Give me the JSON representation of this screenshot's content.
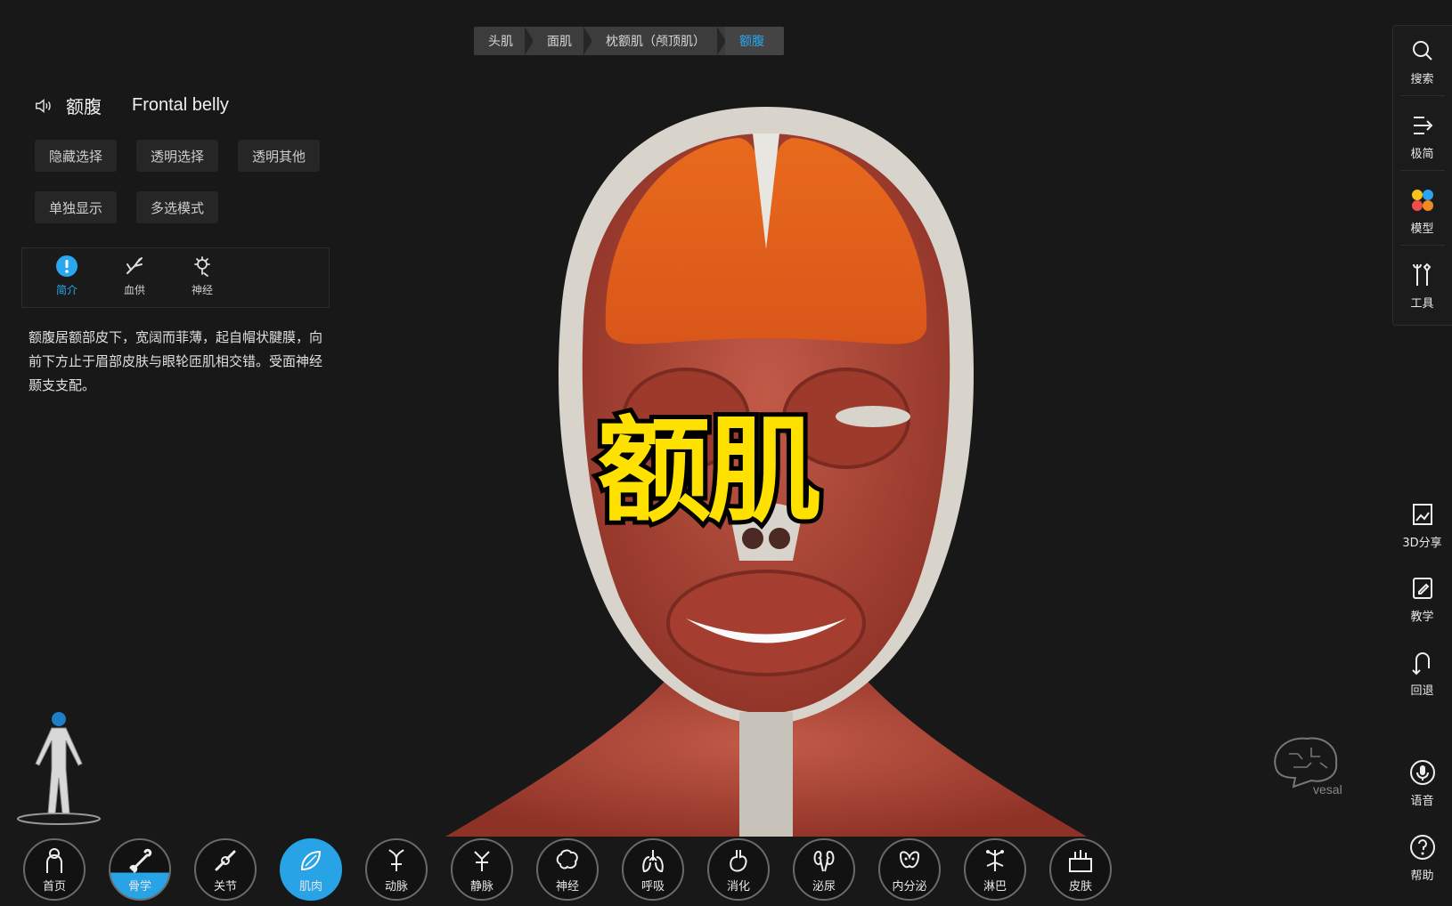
{
  "breadcrumb": [
    "头肌",
    "面肌",
    "枕额肌（颅顶肌）",
    "额腹"
  ],
  "structure": {
    "name_cn": "额腹",
    "name_en": "Frontal belly"
  },
  "actions": {
    "hide_selected": "隐藏选择",
    "transparent_selected": "透明选择",
    "transparent_others": "透明其他",
    "isolate": "单独显示",
    "multi_select": "多选模式"
  },
  "info_tabs": [
    "简介",
    "血供",
    "神经"
  ],
  "description": "额腹居额部皮下，宽阔而菲薄，起自帽状腱膜，向前下方止于眉部皮肤与眼轮匝肌相交错。受面神经颞支支配。",
  "overlay_title": "额肌",
  "right_toolbar": {
    "search": "搜索",
    "minimal": "极简",
    "model": "模型",
    "tools": "工具",
    "share3d": "3D分享",
    "teaching": "教学",
    "back": "回退",
    "voice": "语音",
    "help": "帮助"
  },
  "systems": [
    "首页",
    "骨学",
    "关节",
    "肌肉",
    "动脉",
    "静脉",
    "神经",
    "呼吸",
    "消化",
    "泌尿",
    "内分泌",
    "淋巴",
    "皮肤"
  ],
  "logo_text": "vesal",
  "colors": {
    "accent": "#29a8f0",
    "overlay_text": "#ffe100",
    "muscle": "#b5473a",
    "highlight": "#e0651e"
  }
}
